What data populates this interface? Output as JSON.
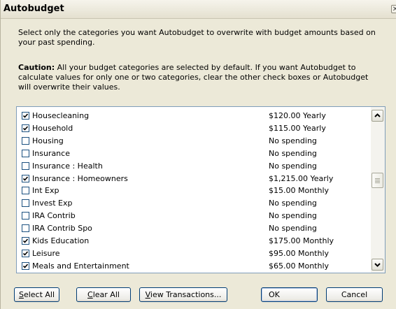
{
  "window": {
    "title": "Autobudget",
    "close_glyph": "✕"
  },
  "intro_text": "Select only the categories you want Autobudget to overwrite with budget amounts based on your past spending.",
  "caution": {
    "label": "Caution:",
    "text": " All your budget categories are selected by default. If you want Autobudget to calculate values for only one or two categories, clear the other check boxes or Autobudget will overwrite their values."
  },
  "categories": [
    {
      "name": "Housecleaning",
      "amount": "$120.00 Yearly",
      "checked": true
    },
    {
      "name": "Household",
      "amount": "$115.00 Yearly",
      "checked": true
    },
    {
      "name": "Housing",
      "amount": "No spending",
      "checked": false
    },
    {
      "name": "Insurance",
      "amount": "No spending",
      "checked": false
    },
    {
      "name": "Insurance : Health",
      "amount": "No spending",
      "checked": false
    },
    {
      "name": "Insurance : Homeowners",
      "amount": "$1,215.00 Yearly",
      "checked": true
    },
    {
      "name": "Int Exp",
      "amount": "$15.00 Monthly",
      "checked": false
    },
    {
      "name": "Invest Exp",
      "amount": "No spending",
      "checked": false
    },
    {
      "name": "IRA Contrib",
      "amount": "No spending",
      "checked": false
    },
    {
      "name": "IRA Contrib Spo",
      "amount": "No spending",
      "checked": false
    },
    {
      "name": "Kids Education",
      "amount": "$175.00 Monthly",
      "checked": true
    },
    {
      "name": "Leisure",
      "amount": "$95.00 Monthly",
      "checked": true
    },
    {
      "name": "Meals and Entertainment",
      "amount": "$65.00 Monthly",
      "checked": true
    }
  ],
  "buttons": {
    "select_all": {
      "key": "S",
      "rest": "elect All"
    },
    "clear_all": {
      "key": "C",
      "rest": "lear All"
    },
    "view_transactions": {
      "key": "V",
      "rest": "iew Transactions..."
    },
    "ok": "OK",
    "cancel": "Cancel"
  },
  "icons": {
    "close": "close-icon",
    "scroll_up": "chevron-up-icon",
    "scroll_down": "chevron-down-icon",
    "checkmark": "checkmark-icon"
  }
}
